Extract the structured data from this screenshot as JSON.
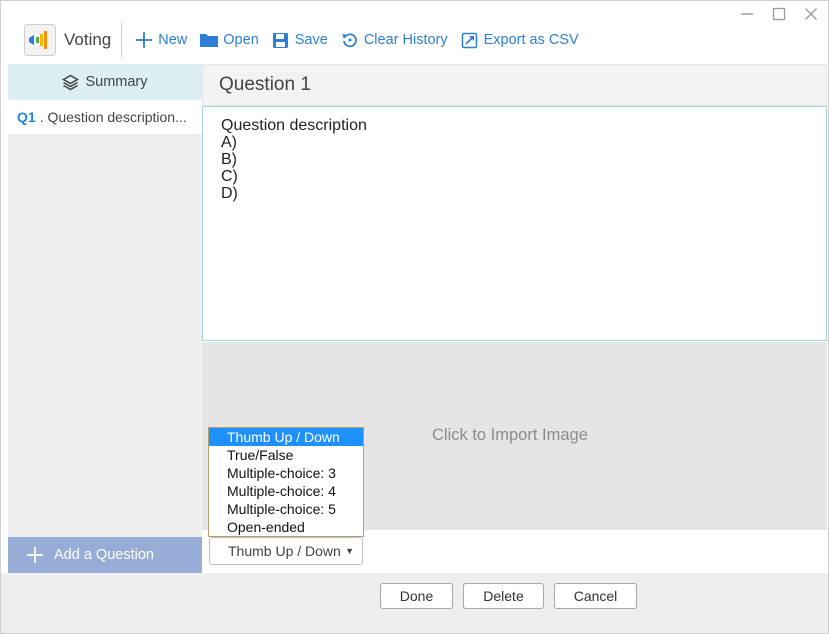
{
  "app": {
    "title": "Voting",
    "accent": "#2d7fd3"
  },
  "toolbar": {
    "new_label": "New",
    "open_label": "Open",
    "save_label": "Save",
    "clear_history_label": "Clear History",
    "export_label": "Export as CSV"
  },
  "sidebar": {
    "summary_label": "Summary",
    "items": [
      {
        "num": "Q1",
        "desc": ". Question description..."
      }
    ],
    "add_question_label": "Add a Question"
  },
  "main": {
    "question_title": "Question 1",
    "question_text": "Question description\nA)\nB)\nC)\nD)",
    "import_image_label": "Click to Import Image",
    "answer_type": {
      "selected": "Thumb Up / Down",
      "options": [
        "Thumb Up / Down",
        "True/False",
        "Multiple-choice: 3",
        "Multiple-choice: 4",
        "Multiple-choice: 5",
        "Open-ended"
      ]
    }
  },
  "footer": {
    "done_label": "Done",
    "delete_label": "Delete",
    "cancel_label": "Cancel"
  }
}
